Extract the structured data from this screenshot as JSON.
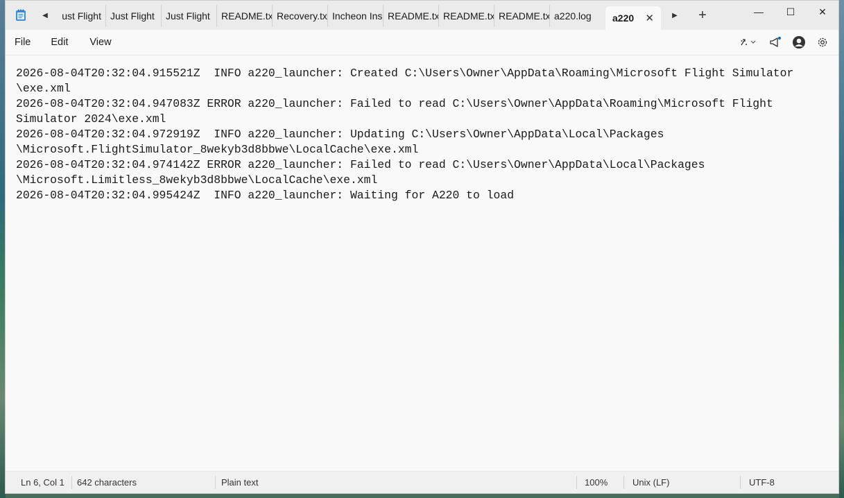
{
  "titlebar": {
    "tabs": [
      {
        "label": "ust Flight"
      },
      {
        "label": "Just Flight"
      },
      {
        "label": "Just Flight"
      },
      {
        "label": "README.tx"
      },
      {
        "label": "Recovery.tx"
      },
      {
        "label": "Incheon Ins"
      },
      {
        "label": "README.tx"
      },
      {
        "label": "README.tx"
      },
      {
        "label": "README.tx"
      },
      {
        "label": "a220.log"
      }
    ],
    "active_tab": {
      "label": "a220",
      "close_glyph": "✕"
    },
    "new_tab_glyph": "+",
    "window_controls": {
      "minimize": "—",
      "maximize": "☐",
      "close": "✕"
    }
  },
  "menu": {
    "file": "File",
    "edit": "Edit",
    "view": "View"
  },
  "editor": {
    "lines": [
      "2026-08-04T20:32:04.915521Z  INFO a220_launcher: Created C:\\Users\\Owner\\AppData\\Roaming\\Microsoft Flight Simulator",
      "\\exe.xml",
      "2026-08-04T20:32:04.947083Z ERROR a220_launcher: Failed to read C:\\Users\\Owner\\AppData\\Roaming\\Microsoft Flight",
      "Simulator 2024\\exe.xml",
      "2026-08-04T20:32:04.972919Z  INFO a220_launcher: Updating C:\\Users\\Owner\\AppData\\Local\\Packages",
      "\\Microsoft.FlightSimulator_8wekyb3d8bbwe\\LocalCache\\exe.xml",
      "2026-08-04T20:32:04.974142Z ERROR a220_launcher: Failed to read C:\\Users\\Owner\\AppData\\Local\\Packages",
      "\\Microsoft.Limitless_8wekyb3d8bbwe\\LocalCache\\exe.xml",
      "2026-08-04T20:32:04.995424Z  INFO a220_launcher: Waiting for A220 to load"
    ]
  },
  "statusbar": {
    "position": "Ln 6, Col 1",
    "characters": "642 characters",
    "format": "Plain text",
    "zoom": "100%",
    "line_endings": "Unix (LF)",
    "encoding": "UTF-8"
  },
  "icons": {
    "app": "notepad-icon",
    "scroll_left": "chevron-left-icon",
    "scroll_right": "chevron-right-icon",
    "copilot": "copilot-icon",
    "publish": "megaphone-icon",
    "account": "account-icon",
    "settings": "gear-icon"
  },
  "colors": {
    "accent": "#0067c0",
    "window_bg": "#f9f9f9",
    "titlebar_bg": "#ebebeb",
    "statusbar_bg": "#f0f0f0"
  }
}
